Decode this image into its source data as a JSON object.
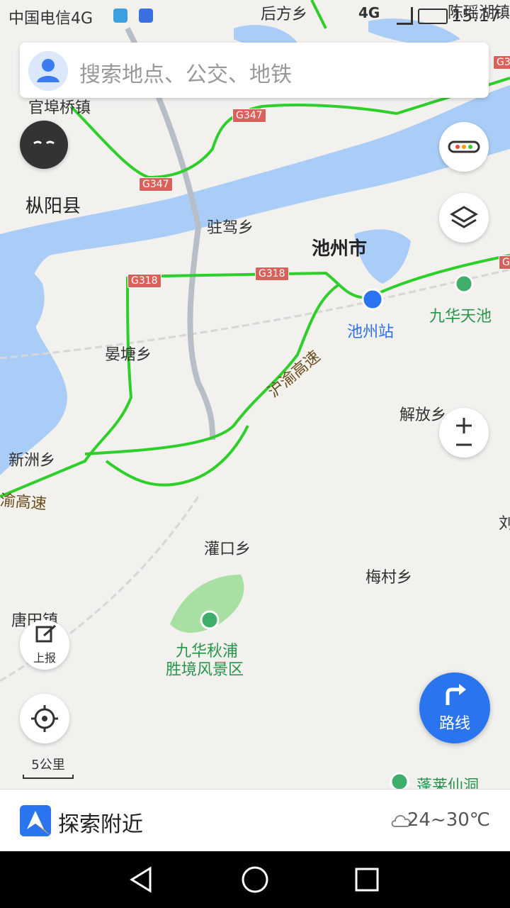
{
  "status_bar": {
    "carrier": "中国电信4G",
    "network": "4G",
    "time": "15:17"
  },
  "search": {
    "placeholder": "搜索地点、公交、地铁"
  },
  "map_labels": {
    "houfang": "后方乡",
    "chenyaohu": "陈瑶湖镇",
    "guanxu": "官埠桥镇",
    "zongyang": "枞阳县",
    "zhujia": "驻驾乡",
    "chizhou": "池州市",
    "jiuhua_tianchi": "九华天池",
    "chizhou_station": "池州站",
    "yantang": "晏塘乡",
    "jiefang": "解放乡",
    "xinzhou": "新洲乡",
    "guankou": "灌口乡",
    "meicun": "梅村乡",
    "liu": "刘",
    "tangtian": "唐田镇",
    "jiuhua_qiupu": "九华秋浦",
    "jiuhua_qiupu2": "胜境风景区",
    "penglai": "蓬莱仙洞",
    "hu_yu_1": "沪渝高速",
    "hu_yu_2": "渝高速"
  },
  "road_shields": {
    "g347_top": "G347",
    "g347_left": "G347",
    "g318_left": "G318",
    "g318_mid": "G318",
    "g3_top": "G3",
    "g3_right": "G3"
  },
  "buttons": {
    "report": "上报",
    "route": "路线"
  },
  "scale": "5公里",
  "bottom_bar": {
    "title": "探索附近",
    "weather": "24~30℃"
  },
  "colors": {
    "water": "#a9cdf7",
    "land": "#f2f1ee",
    "highway": "#2fcf2b",
    "accent": "#2a74f0"
  }
}
